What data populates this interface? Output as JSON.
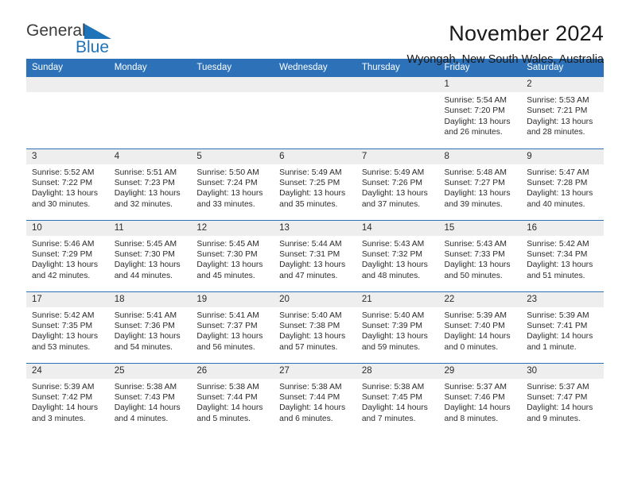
{
  "brand": {
    "name_top": "General",
    "name_bottom": "Blue",
    "triangle_icon": "blue-triangle-icon",
    "colors": {
      "text": "#3c3c3c",
      "blue": "#1f73b8"
    }
  },
  "header": {
    "title": "November 2024",
    "subtitle": "Wyongah, New South Wales, Australia"
  },
  "theme": {
    "header_blue": "#2d72b8",
    "daynum_band": "#eeeeee",
    "cell_background": "#ffffff",
    "text": "#2b2b2b"
  },
  "calendar": {
    "weekdays": [
      "Sunday",
      "Monday",
      "Tuesday",
      "Wednesday",
      "Thursday",
      "Friday",
      "Saturday"
    ],
    "weeks": [
      [
        {
          "day": "",
          "lines": []
        },
        {
          "day": "",
          "lines": []
        },
        {
          "day": "",
          "lines": []
        },
        {
          "day": "",
          "lines": []
        },
        {
          "day": "",
          "lines": []
        },
        {
          "day": "1",
          "lines": [
            "Sunrise: 5:54 AM",
            "Sunset: 7:20 PM",
            "Daylight: 13 hours",
            "and 26 minutes."
          ]
        },
        {
          "day": "2",
          "lines": [
            "Sunrise: 5:53 AM",
            "Sunset: 7:21 PM",
            "Daylight: 13 hours",
            "and 28 minutes."
          ]
        }
      ],
      [
        {
          "day": "3",
          "lines": [
            "Sunrise: 5:52 AM",
            "Sunset: 7:22 PM",
            "Daylight: 13 hours",
            "and 30 minutes."
          ]
        },
        {
          "day": "4",
          "lines": [
            "Sunrise: 5:51 AM",
            "Sunset: 7:23 PM",
            "Daylight: 13 hours",
            "and 32 minutes."
          ]
        },
        {
          "day": "5",
          "lines": [
            "Sunrise: 5:50 AM",
            "Sunset: 7:24 PM",
            "Daylight: 13 hours",
            "and 33 minutes."
          ]
        },
        {
          "day": "6",
          "lines": [
            "Sunrise: 5:49 AM",
            "Sunset: 7:25 PM",
            "Daylight: 13 hours",
            "and 35 minutes."
          ]
        },
        {
          "day": "7",
          "lines": [
            "Sunrise: 5:49 AM",
            "Sunset: 7:26 PM",
            "Daylight: 13 hours",
            "and 37 minutes."
          ]
        },
        {
          "day": "8",
          "lines": [
            "Sunrise: 5:48 AM",
            "Sunset: 7:27 PM",
            "Daylight: 13 hours",
            "and 39 minutes."
          ]
        },
        {
          "day": "9",
          "lines": [
            "Sunrise: 5:47 AM",
            "Sunset: 7:28 PM",
            "Daylight: 13 hours",
            "and 40 minutes."
          ]
        }
      ],
      [
        {
          "day": "10",
          "lines": [
            "Sunrise: 5:46 AM",
            "Sunset: 7:29 PM",
            "Daylight: 13 hours",
            "and 42 minutes."
          ]
        },
        {
          "day": "11",
          "lines": [
            "Sunrise: 5:45 AM",
            "Sunset: 7:30 PM",
            "Daylight: 13 hours",
            "and 44 minutes."
          ]
        },
        {
          "day": "12",
          "lines": [
            "Sunrise: 5:45 AM",
            "Sunset: 7:30 PM",
            "Daylight: 13 hours",
            "and 45 minutes."
          ]
        },
        {
          "day": "13",
          "lines": [
            "Sunrise: 5:44 AM",
            "Sunset: 7:31 PM",
            "Daylight: 13 hours",
            "and 47 minutes."
          ]
        },
        {
          "day": "14",
          "lines": [
            "Sunrise: 5:43 AM",
            "Sunset: 7:32 PM",
            "Daylight: 13 hours",
            "and 48 minutes."
          ]
        },
        {
          "day": "15",
          "lines": [
            "Sunrise: 5:43 AM",
            "Sunset: 7:33 PM",
            "Daylight: 13 hours",
            "and 50 minutes."
          ]
        },
        {
          "day": "16",
          "lines": [
            "Sunrise: 5:42 AM",
            "Sunset: 7:34 PM",
            "Daylight: 13 hours",
            "and 51 minutes."
          ]
        }
      ],
      [
        {
          "day": "17",
          "lines": [
            "Sunrise: 5:42 AM",
            "Sunset: 7:35 PM",
            "Daylight: 13 hours",
            "and 53 minutes."
          ]
        },
        {
          "day": "18",
          "lines": [
            "Sunrise: 5:41 AM",
            "Sunset: 7:36 PM",
            "Daylight: 13 hours",
            "and 54 minutes."
          ]
        },
        {
          "day": "19",
          "lines": [
            "Sunrise: 5:41 AM",
            "Sunset: 7:37 PM",
            "Daylight: 13 hours",
            "and 56 minutes."
          ]
        },
        {
          "day": "20",
          "lines": [
            "Sunrise: 5:40 AM",
            "Sunset: 7:38 PM",
            "Daylight: 13 hours",
            "and 57 minutes."
          ]
        },
        {
          "day": "21",
          "lines": [
            "Sunrise: 5:40 AM",
            "Sunset: 7:39 PM",
            "Daylight: 13 hours",
            "and 59 minutes."
          ]
        },
        {
          "day": "22",
          "lines": [
            "Sunrise: 5:39 AM",
            "Sunset: 7:40 PM",
            "Daylight: 14 hours",
            "and 0 minutes."
          ]
        },
        {
          "day": "23",
          "lines": [
            "Sunrise: 5:39 AM",
            "Sunset: 7:41 PM",
            "Daylight: 14 hours",
            "and 1 minute."
          ]
        }
      ],
      [
        {
          "day": "24",
          "lines": [
            "Sunrise: 5:39 AM",
            "Sunset: 7:42 PM",
            "Daylight: 14 hours",
            "and 3 minutes."
          ]
        },
        {
          "day": "25",
          "lines": [
            "Sunrise: 5:38 AM",
            "Sunset: 7:43 PM",
            "Daylight: 14 hours",
            "and 4 minutes."
          ]
        },
        {
          "day": "26",
          "lines": [
            "Sunrise: 5:38 AM",
            "Sunset: 7:44 PM",
            "Daylight: 14 hours",
            "and 5 minutes."
          ]
        },
        {
          "day": "27",
          "lines": [
            "Sunrise: 5:38 AM",
            "Sunset: 7:44 PM",
            "Daylight: 14 hours",
            "and 6 minutes."
          ]
        },
        {
          "day": "28",
          "lines": [
            "Sunrise: 5:38 AM",
            "Sunset: 7:45 PM",
            "Daylight: 14 hours",
            "and 7 minutes."
          ]
        },
        {
          "day": "29",
          "lines": [
            "Sunrise: 5:37 AM",
            "Sunset: 7:46 PM",
            "Daylight: 14 hours",
            "and 8 minutes."
          ]
        },
        {
          "day": "30",
          "lines": [
            "Sunrise: 5:37 AM",
            "Sunset: 7:47 PM",
            "Daylight: 14 hours",
            "and 9 minutes."
          ]
        }
      ]
    ]
  }
}
